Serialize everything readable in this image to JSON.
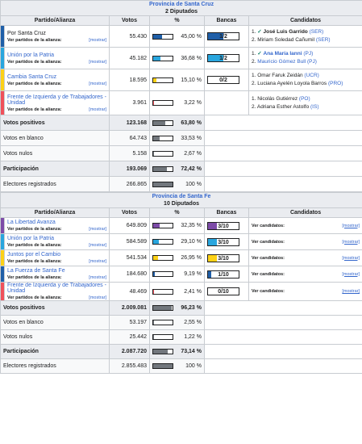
{
  "header_labels": {
    "party": "Partido/Alianza",
    "votes": "Votos",
    "pct": "%",
    "seats": "Bancas",
    "candidates": "Candidatos",
    "ver_partidos": "Ver partidos de la alianza:",
    "mostrar": "[mostrar]",
    "ver_candidatos": "Ver candidatos:"
  },
  "provinces": [
    {
      "title": "Provincia de Santa Cruz",
      "subtitle": "2 Diputados",
      "parties": [
        {
          "name": "Por Santa Cruz",
          "color": "#1f5fa8",
          "link": false,
          "votes": "55.430",
          "pct": "45,00 %",
          "pct_value": 45.0,
          "seats": "1/2",
          "seats_fraction": 0.5,
          "candidates": [
            {
              "n": "1.",
              "name": "José Luis Garrido",
              "party": "(SER)",
              "elected": true
            },
            {
              "n": "2.",
              "name": "Miriam Soledad Cañumil",
              "party": "(SER)",
              "elected": false
            }
          ]
        },
        {
          "name": "Unión por la Patria",
          "color": "#29a6de",
          "link": true,
          "votes": "45.182",
          "pct": "36,68 %",
          "pct_value": 36.68,
          "seats": "1/2",
          "seats_fraction": 0.5,
          "candidates": [
            {
              "n": "1.",
              "name": "Ana María Ianni",
              "party": "(PJ)",
              "elected": true,
              "link": true
            },
            {
              "n": "2.",
              "name": "Mauricio Gómez Bull",
              "party": "(PJ)",
              "elected": false,
              "link": true
            }
          ]
        },
        {
          "name": "Cambia Santa Cruz",
          "color": "#fcd116",
          "link": true,
          "votes": "18.595",
          "pct": "15,10 %",
          "pct_value": 15.1,
          "seats": "0/2",
          "seats_fraction": 0,
          "candidates": [
            {
              "n": "1.",
              "name": "Omar Faruk Zeidán",
              "party": "(UCR)",
              "elected": false
            },
            {
              "n": "2.",
              "name": "Luciana Ayelén Loyola Barros",
              "party": "(PRO)",
              "elected": false
            }
          ]
        },
        {
          "name": "Frente de Izquierda y de Trabajadores - Unidad",
          "color": "#f0505a",
          "link": true,
          "votes": "3.961",
          "pct": "3,22 %",
          "pct_value": 3.22,
          "seats": "",
          "seats_fraction": 0,
          "candidates": [
            {
              "n": "1.",
              "name": "Nicolás Gutiérrez",
              "party": "(PO)",
              "elected": false
            },
            {
              "n": "2.",
              "name": "Adriana Esther Astolfo",
              "party": "(IS)",
              "elected": false
            }
          ]
        }
      ],
      "summary": [
        {
          "label": "Votos positivos",
          "votes": "123.168",
          "pct": "63,80 %",
          "pct_value": 63.8,
          "style": "sum"
        },
        {
          "label": "Votos en blanco",
          "votes": "64.743",
          "pct": "33,53 %",
          "pct_value": 33.53,
          "style": "plain"
        },
        {
          "label": "Votos nulos",
          "votes": "5.158",
          "pct": "2,67 %",
          "pct_value": 2.67,
          "style": "plain"
        },
        {
          "label": "Participación",
          "votes": "193.069",
          "pct": "72,42 %",
          "pct_value": 72.42,
          "style": "sum"
        },
        {
          "label": "Electores registrados",
          "votes": "266.865",
          "pct": "100 %",
          "pct_value": 100,
          "style": "plain"
        }
      ]
    },
    {
      "title": "Provincia de Santa Fe",
      "subtitle": "10 Diputados",
      "parties": [
        {
          "name": "La Libertad Avanza",
          "color": "#7d4ba8",
          "link": true,
          "votes": "649.809",
          "pct": "32,35 %",
          "pct_value": 32.35,
          "seats": "3/10",
          "seats_fraction": 0.3
        },
        {
          "name": "Unión por la Patria",
          "color": "#29a6de",
          "link": true,
          "votes": "584.589",
          "pct": "29,10 %",
          "pct_value": 29.1,
          "seats": "3/10",
          "seats_fraction": 0.3
        },
        {
          "name": "Juntos por el Cambio",
          "color": "#fcd116",
          "link": true,
          "votes": "541.534",
          "pct": "26,95 %",
          "pct_value": 26.95,
          "seats": "3/10",
          "seats_fraction": 0.3
        },
        {
          "name": "La Fuerza de Santa Fe",
          "color": "#1f5fa8",
          "link": true,
          "votes": "184.680",
          "pct": "9,19 %",
          "pct_value": 9.19,
          "seats": "1/10",
          "seats_fraction": 0.1
        },
        {
          "name": "Frente de Izquierda y de Trabajadores - Unidad",
          "color": "#f0505a",
          "link": true,
          "votes": "48.469",
          "pct": "2,41 %",
          "pct_value": 2.41,
          "seats": "0/10",
          "seats_fraction": 0
        }
      ],
      "summary": [
        {
          "label": "Votos positivos",
          "votes": "2.009.081",
          "pct": "96,23 %",
          "pct_value": 96.23,
          "style": "sum"
        },
        {
          "label": "Votos en blanco",
          "votes": "53.197",
          "pct": "2,55 %",
          "pct_value": 2.55,
          "style": "plain"
        },
        {
          "label": "Votos nulos",
          "votes": "25.442",
          "pct": "1,22 %",
          "pct_value": 1.22,
          "style": "plain"
        },
        {
          "label": "Participación",
          "votes": "2.087.720",
          "pct": "73,14 %",
          "pct_value": 73.14,
          "style": "sum"
        },
        {
          "label": "Electores registrados",
          "votes": "2.855.483",
          "pct": "100 %",
          "pct_value": 100,
          "style": "plain"
        }
      ]
    }
  ]
}
